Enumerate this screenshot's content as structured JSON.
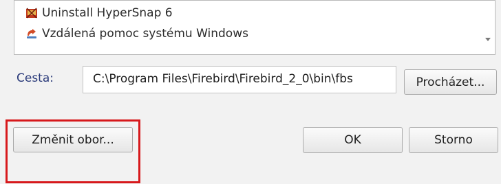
{
  "program_list": {
    "items": [
      {
        "label": "Uninstall HyperSnap 6",
        "icon": "hypersnap-uninstall-icon"
      },
      {
        "label": "Vzdálená pomoc systému Windows",
        "icon": "remote-assistance-icon"
      },
      {
        "label": "",
        "icon": ""
      }
    ]
  },
  "path": {
    "label": "Cesta:",
    "value": "C:\\Program Files\\Firebird\\Firebird_2_0\\bin\\fbs"
  },
  "buttons": {
    "browse": "Procházet...",
    "change_scope": "Změnit obor...",
    "ok": "OK",
    "cancel": "Storno"
  },
  "colors": {
    "highlight": "#d7191c"
  }
}
